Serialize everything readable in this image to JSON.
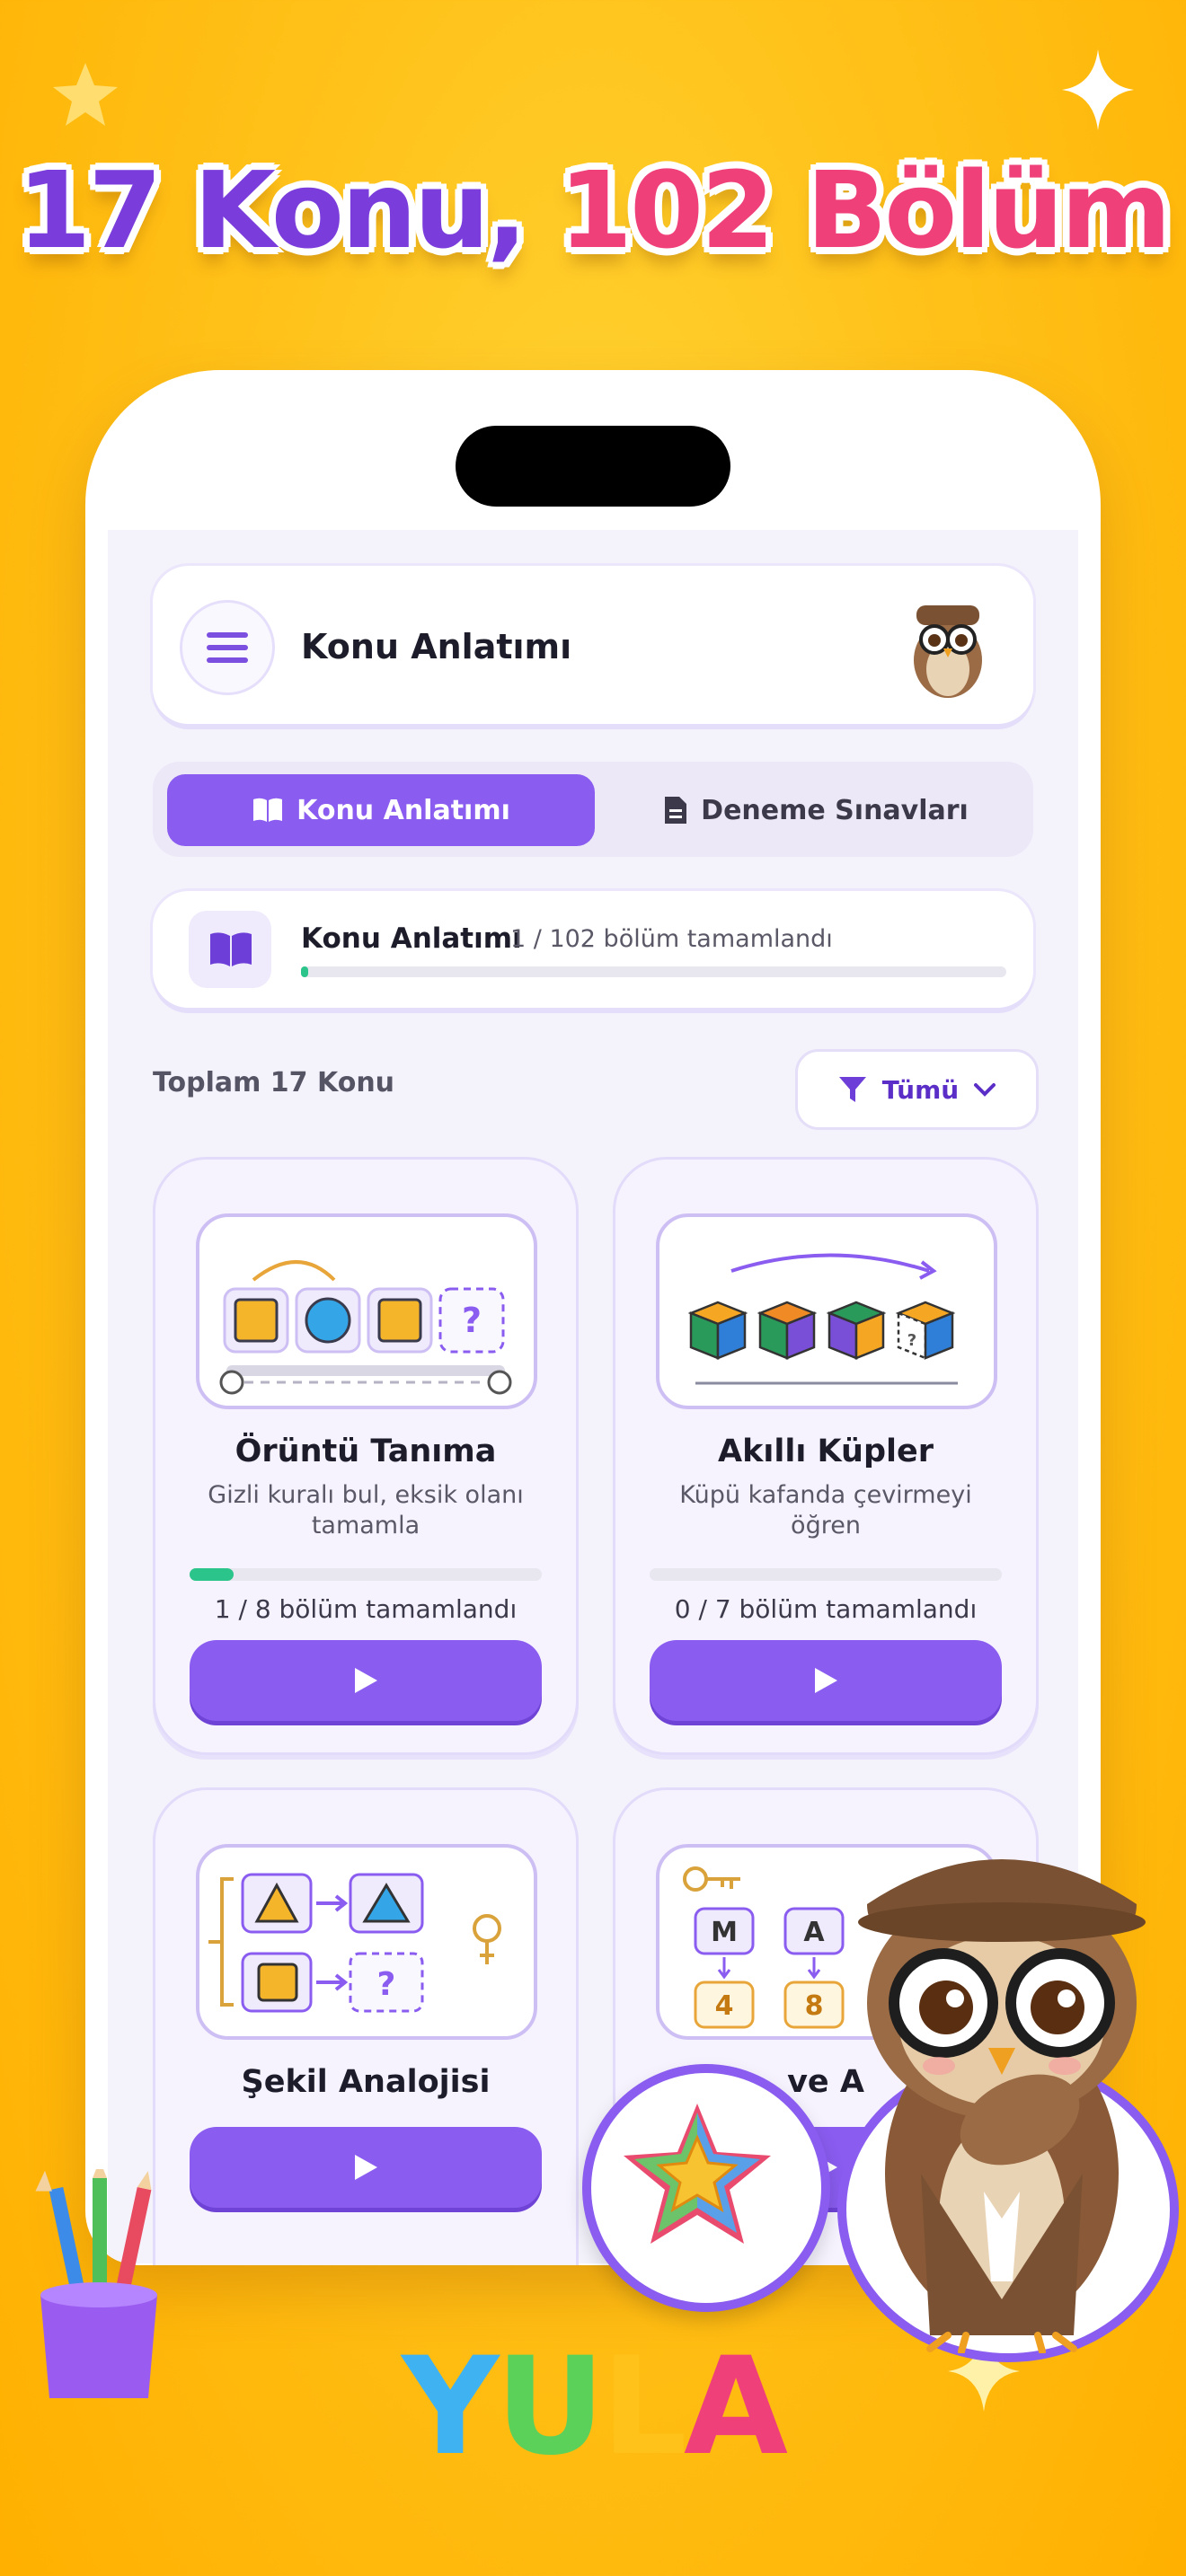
{
  "headline": {
    "part1": "17 Konu,",
    "part2": "102 Bölüm"
  },
  "header": {
    "title": "Konu Anlatımı"
  },
  "tabs": [
    {
      "label": "Konu Anlatımı",
      "active": true
    },
    {
      "label": "Deneme Sınavları",
      "active": false
    }
  ],
  "progress": {
    "title": "Konu Anlatımı",
    "subtitle": "1 / 102 bölüm tamamlandı",
    "completed": 1,
    "total": 102
  },
  "list": {
    "total_label": "Toplam 17 Konu",
    "filter_label": "Tümü"
  },
  "topics": [
    {
      "title": "Örüntü Tanıma",
      "description": "Gizli kuralı bul, eksik olanı tamamla",
      "count": "1 / 8 bölüm tamamlandı",
      "completed": 1,
      "total": 8
    },
    {
      "title": "Akıllı Küpler",
      "description": "Küpü kafanda çevirmeyi öğren",
      "count": "0 / 7 bölüm tamamlandı",
      "completed": 0,
      "total": 7
    },
    {
      "title": "Şekil Analojisi"
    },
    {
      "title": "ve A"
    }
  ],
  "illus_glyphs": {
    "question": "?",
    "m": "M",
    "a": "A",
    "four": "4",
    "eight": "8"
  },
  "brand": {
    "logo": [
      "Y",
      "U",
      "L",
      "A"
    ]
  },
  "colors": {
    "accent": "#8a5cf0",
    "progress": "#2bc48a",
    "background": "#ffc21a",
    "headline_purple": "#7a3ddb",
    "headline_pink": "#f0407a"
  }
}
